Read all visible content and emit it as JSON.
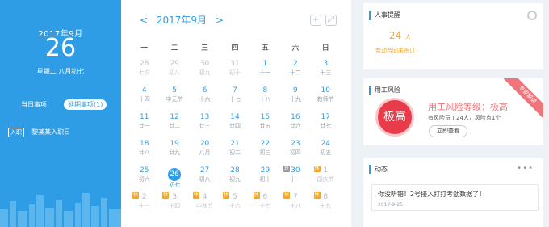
{
  "left": {
    "year_month": "2017年9月",
    "day": "26",
    "lunar": "星期二 八月初七",
    "tab_today": "当日事项",
    "tab_overdue": "延期事项(1)",
    "event_tag": "入职",
    "event_text": "黎某某入职日"
  },
  "calendar": {
    "prev": "<",
    "title": "2017年9月",
    "next": ">",
    "add_icon": "plus-icon",
    "expand_icon": "expand-icon",
    "weekdays": [
      "一",
      "二",
      "三",
      "四",
      "五",
      "六",
      "日"
    ],
    "rows": [
      [
        {
          "g": "28",
          "l": "七夕",
          "muted": true
        },
        {
          "g": "29",
          "l": "初八",
          "muted": true
        },
        {
          "g": "30",
          "l": "初九",
          "muted": true
        },
        {
          "g": "31",
          "l": "初十",
          "muted": true
        },
        {
          "g": "1",
          "l": "十一"
        },
        {
          "g": "2",
          "l": "十二"
        },
        {
          "g": "3",
          "l": "十三"
        }
      ],
      [
        {
          "g": "4",
          "l": "十四"
        },
        {
          "g": "5",
          "l": "中元节"
        },
        {
          "g": "6",
          "l": "十六"
        },
        {
          "g": "7",
          "l": "十七"
        },
        {
          "g": "8",
          "l": "十八"
        },
        {
          "g": "9",
          "l": "十九"
        },
        {
          "g": "10",
          "l": "教师节"
        }
      ],
      [
        {
          "g": "11",
          "l": "廿一"
        },
        {
          "g": "12",
          "l": "廿二"
        },
        {
          "g": "13",
          "l": "廿三"
        },
        {
          "g": "14",
          "l": "廿四"
        },
        {
          "g": "15",
          "l": "廿五"
        },
        {
          "g": "16",
          "l": "廿六"
        },
        {
          "g": "17",
          "l": "廿七"
        }
      ],
      [
        {
          "g": "18",
          "l": "廿八"
        },
        {
          "g": "19",
          "l": "廿九"
        },
        {
          "g": "20",
          "l": "八月"
        },
        {
          "g": "21",
          "l": "初二"
        },
        {
          "g": "22",
          "l": "初三"
        },
        {
          "g": "23",
          "l": "初四"
        },
        {
          "g": "24",
          "l": "初五"
        }
      ],
      [
        {
          "g": "25",
          "l": "初六"
        },
        {
          "g": "26",
          "l": "初七",
          "today": true
        },
        {
          "g": "27",
          "l": "初八"
        },
        {
          "g": "28",
          "l": "初九"
        },
        {
          "g": "29",
          "l": "初十"
        },
        {
          "g": "30",
          "l": "十一",
          "badge": "班",
          "badge_gray": true
        },
        {
          "g": "1",
          "l": "国庆节",
          "muted": true,
          "badge": "休"
        }
      ],
      [
        {
          "g": "2",
          "l": "十三",
          "muted": true,
          "badge": "休"
        },
        {
          "g": "3",
          "l": "十四",
          "muted": true,
          "badge": "休"
        },
        {
          "g": "4",
          "l": "中秋节",
          "muted": true,
          "badge": "休"
        },
        {
          "g": "5",
          "l": "十六",
          "muted": true,
          "badge": "休"
        },
        {
          "g": "6",
          "l": "十七",
          "muted": true,
          "badge": "休"
        },
        {
          "g": "7",
          "l": "十八",
          "muted": true,
          "badge": "休"
        },
        {
          "g": "8",
          "l": "十九",
          "muted": true,
          "badge": "休"
        }
      ]
    ]
  },
  "hr_reminder": {
    "title": "人事提醒",
    "count": "24",
    "count_unit": "人",
    "desc": "劳动合同未签订"
  },
  "risk": {
    "title": "用工风险",
    "ribbon": "专家解读",
    "circle": "极高",
    "level": "用工风险等级：极高",
    "desc": "有风险员工24人，风险点1个",
    "button": "立即查看"
  },
  "feed": {
    "title": "动态",
    "more": "•••",
    "text": "你没听错！2号接入打打考勤数据了！",
    "date": "2017-9-25"
  },
  "colors": {
    "accent": "#2f9de6",
    "warning": "#f5a623",
    "danger": "#e83c4a"
  }
}
